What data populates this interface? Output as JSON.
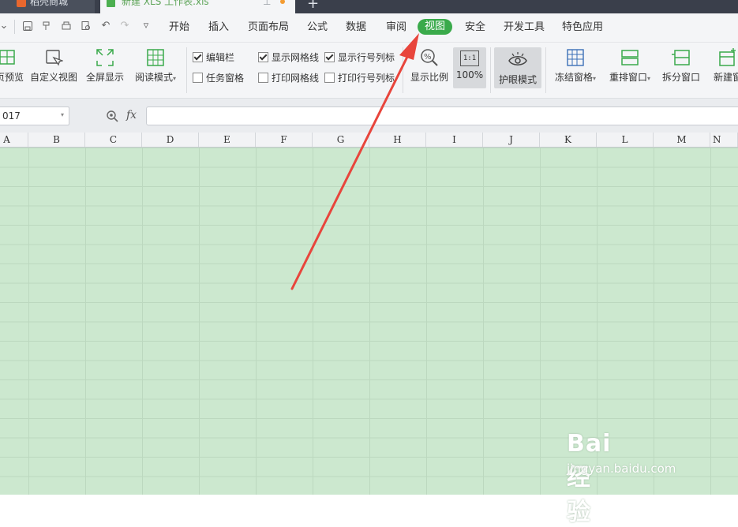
{
  "tabs": [
    {
      "label": "稻壳商城"
    },
    {
      "label": "新建 XLS 工作表.xls"
    }
  ],
  "menu": [
    "开始",
    "插入",
    "页面布局",
    "公式",
    "数据",
    "审阅",
    "视图",
    "安全",
    "开发工具",
    "特色应用"
  ],
  "ribbon": {
    "buttons": {
      "preview": "页预览",
      "custom_view": "自定义视图",
      "fullscreen": "全屏显示",
      "read_mode": "阅读模式",
      "zoom_ratio": "显示比例",
      "zoom_100": "100%",
      "zoom_100_icon": "1:1",
      "eye_mode": "护眼模式",
      "freeze": "冻结窗格",
      "arrange": "重排窗口",
      "split": "拆分窗口",
      "new_window": "新建窗"
    },
    "checks": {
      "edit_bar": {
        "label": "编辑栏",
        "checked": true
      },
      "task_pane": {
        "label": "任务窗格",
        "checked": false
      },
      "show_grid": {
        "label": "显示网格线",
        "checked": true
      },
      "print_grid": {
        "label": "打印网格线",
        "checked": false
      },
      "show_rowcol": {
        "label": "显示行号列标",
        "checked": true
      },
      "print_rowcol": {
        "label": "打印行号列标",
        "checked": false
      }
    }
  },
  "formula_bar": {
    "namebox": "017",
    "fx": "fx",
    "formula": ""
  },
  "columns": [
    "A",
    "B",
    "C",
    "D",
    "E",
    "F",
    "G",
    "H",
    "I",
    "J",
    "K",
    "L",
    "M",
    "N"
  ],
  "watermark": {
    "brand": "Bai 经验",
    "url": "jingyan.baidu.com"
  },
  "colors": {
    "accent": "#3aaa4b",
    "eye_green": "#cce8cf",
    "arrow": "#e8453c"
  }
}
